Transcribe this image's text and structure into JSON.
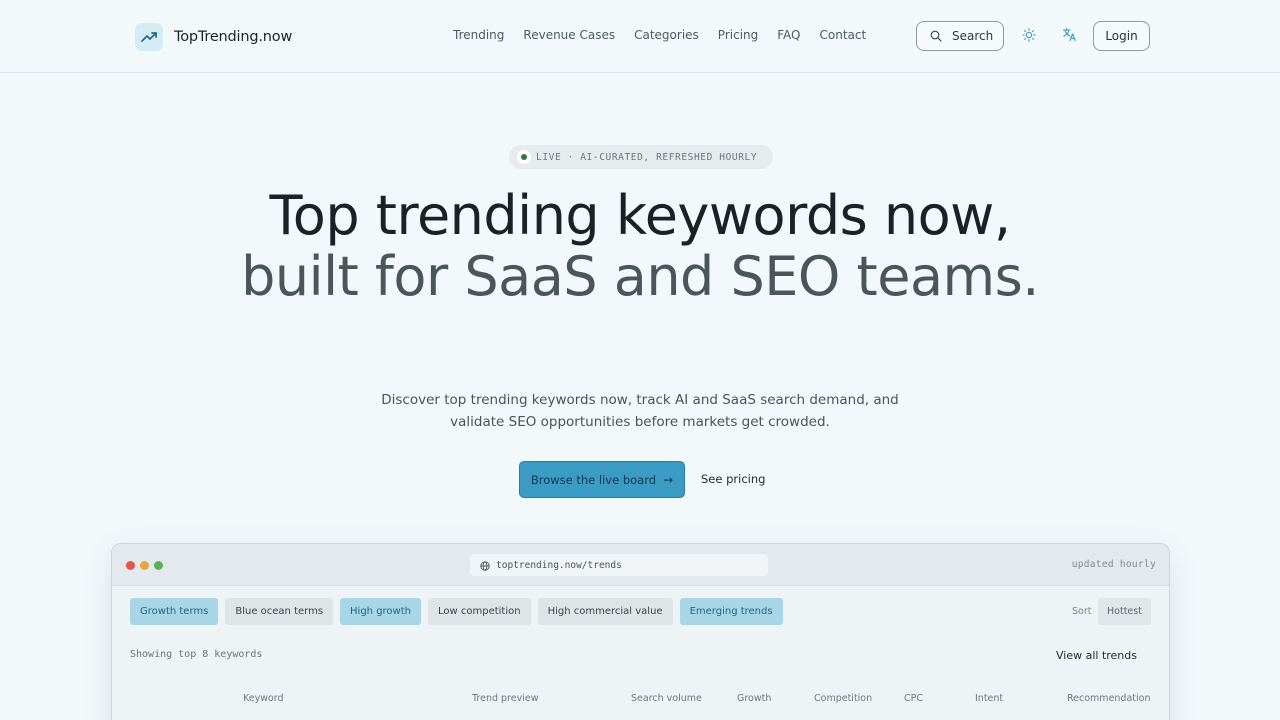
{
  "brand": {
    "name": "TopTrending.now"
  },
  "nav": [
    "Trending",
    "Revenue Cases",
    "Categories",
    "Pricing",
    "FAQ",
    "Contact"
  ],
  "header": {
    "search_label": "Search",
    "login_label": "Login"
  },
  "hero": {
    "badge": "LIVE · AI-CURATED, REFRESHED HOURLY",
    "title_line1": "Top trending keywords now,",
    "title_line2": "built for SaaS and SEO teams.",
    "subtitle": "Discover top trending keywords now, track AI and SaaS search demand, and validate SEO opportunities before markets get crowded.",
    "primary_cta": "Browse the live board",
    "secondary_cta": "See pricing"
  },
  "browser": {
    "url": "toptrending.now/trends",
    "updated": "updated hourly",
    "filters": [
      {
        "label": "Growth terms",
        "active": true
      },
      {
        "label": "Blue ocean terms",
        "active": false
      },
      {
        "label": "High growth",
        "active": true
      },
      {
        "label": "Low competition",
        "active": false
      },
      {
        "label": "High commercial value",
        "active": false
      },
      {
        "label": "Emerging trends",
        "active": true
      }
    ],
    "sort_label": "Sort",
    "sort_value": "Hottest",
    "showing": "Showing top 8 keywords",
    "view_all": "View all trends",
    "columns": [
      "Keyword",
      "Trend preview",
      "Search volume",
      "Growth",
      "Competition",
      "CPC",
      "Intent",
      "Recommendation"
    ]
  },
  "colors": {
    "accent": "#3a9bc5",
    "chip_active_bg": "#a9d6e7",
    "live_dot": "#2f7a3b"
  }
}
